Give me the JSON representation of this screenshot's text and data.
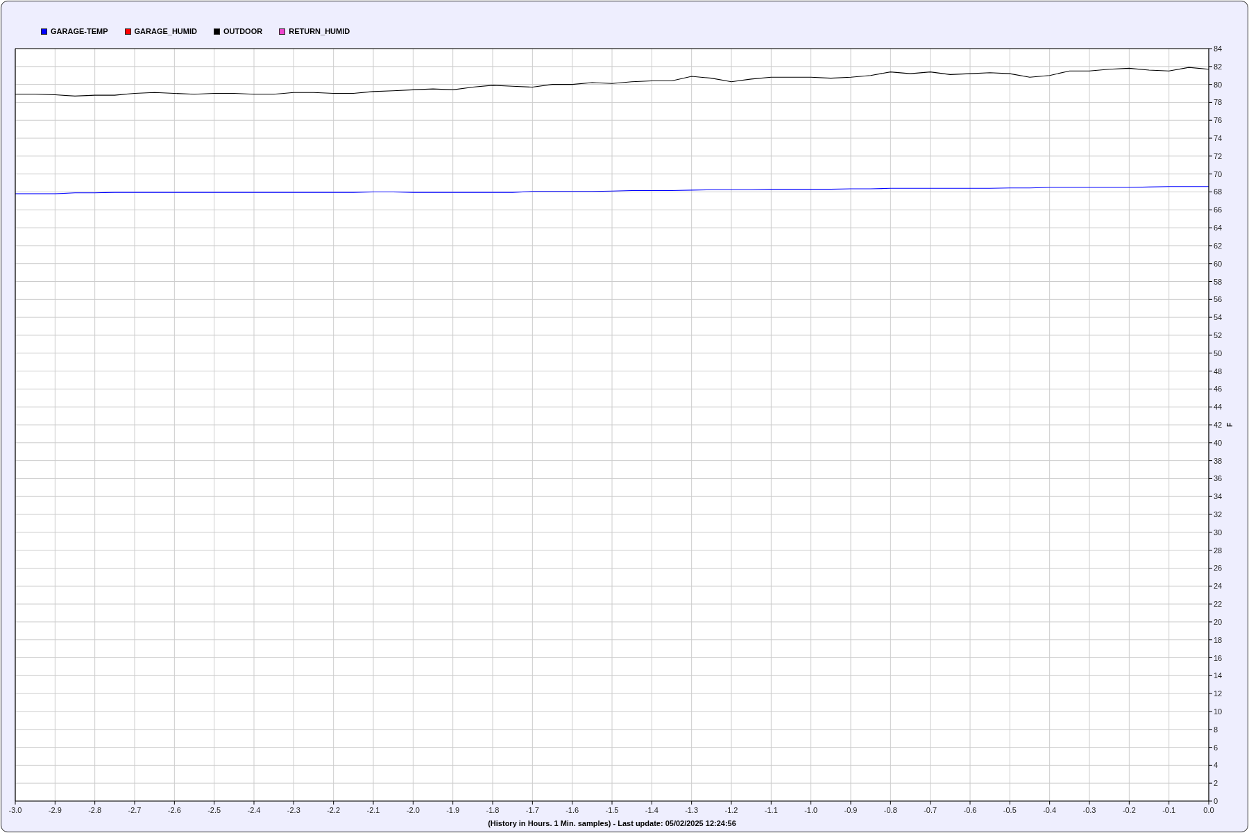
{
  "chart": {
    "chart_data": {
      "type": "line",
      "grid": true,
      "xlabel": "(History in Hours. 1 Min. samples) - Last update: 05/02/2025 12:24:56",
      "ylabel": "F",
      "x": [
        -3.0,
        -2.95,
        -2.9,
        -2.85,
        -2.8,
        -2.75,
        -2.7,
        -2.65,
        -2.6,
        -2.55,
        -2.5,
        -2.45,
        -2.4,
        -2.35,
        -2.3,
        -2.25,
        -2.2,
        -2.15,
        -2.1,
        -2.05,
        -2.0,
        -1.95,
        -1.9,
        -1.85,
        -1.8,
        -1.75,
        -1.7,
        -1.65,
        -1.6,
        -1.55,
        -1.5,
        -1.45,
        -1.4,
        -1.35,
        -1.3,
        -1.25,
        -1.2,
        -1.15,
        -1.1,
        -1.05,
        -1.0,
        -0.95,
        -0.9,
        -0.85,
        -0.8,
        -0.75,
        -0.7,
        -0.65,
        -0.6,
        -0.55,
        -0.5,
        -0.45,
        -0.4,
        -0.35,
        -0.3,
        -0.25,
        -0.2,
        -0.15,
        -0.1,
        -0.05,
        0.0
      ],
      "series": [
        {
          "name": "GARAGE-TEMP",
          "color": "#0000ff",
          "values": [
            67.8,
            67.8,
            67.8,
            67.9,
            67.9,
            67.95,
            67.95,
            67.95,
            67.95,
            67.95,
            67.95,
            67.95,
            67.95,
            67.95,
            67.95,
            67.95,
            67.95,
            67.95,
            68.0,
            68.0,
            67.95,
            67.95,
            67.95,
            67.95,
            67.95,
            67.95,
            68.05,
            68.05,
            68.05,
            68.05,
            68.1,
            68.15,
            68.15,
            68.15,
            68.2,
            68.25,
            68.25,
            68.25,
            68.3,
            68.3,
            68.3,
            68.3,
            68.35,
            68.35,
            68.4,
            68.4,
            68.4,
            68.4,
            68.4,
            68.4,
            68.45,
            68.45,
            68.5,
            68.5,
            68.5,
            68.5,
            68.5,
            68.55,
            68.6,
            68.6,
            68.6
          ]
        },
        {
          "name": "GARAGE_HUMID",
          "color": "#ff0000",
          "values": [
            null,
            null,
            null,
            null,
            null,
            null,
            null,
            null,
            null,
            null,
            null,
            null,
            null,
            null,
            null,
            null,
            null,
            null,
            null,
            null,
            null,
            null,
            null,
            null,
            null,
            null,
            null,
            null,
            null,
            null,
            null,
            null,
            null,
            null,
            null,
            null,
            null,
            null,
            null,
            null,
            null,
            null,
            null,
            null,
            null,
            null,
            null,
            null,
            null,
            null,
            null,
            null,
            null,
            null,
            null,
            null,
            null,
            null,
            null,
            null,
            null
          ]
        },
        {
          "name": "OUTDOOR",
          "color": "#000000",
          "values": [
            78.9,
            78.9,
            78.85,
            78.7,
            78.8,
            78.8,
            79.0,
            79.1,
            79.0,
            78.9,
            79.0,
            79.0,
            78.9,
            78.9,
            79.1,
            79.1,
            79.0,
            79.0,
            79.2,
            79.3,
            79.4,
            79.5,
            79.4,
            79.7,
            79.9,
            79.8,
            79.7,
            80.0,
            80.0,
            80.2,
            80.1,
            80.3,
            80.4,
            80.4,
            80.9,
            80.7,
            80.3,
            80.6,
            80.8,
            80.8,
            80.8,
            80.7,
            80.8,
            81.0,
            81.4,
            81.2,
            81.4,
            81.1,
            81.2,
            81.3,
            81.2,
            80.8,
            81.0,
            81.5,
            81.5,
            81.7,
            81.8,
            81.6,
            81.5,
            81.9,
            81.7
          ]
        },
        {
          "name": "RETURN_HUMID",
          "color": "#ee44cc",
          "values": [
            null,
            null,
            null,
            null,
            null,
            null,
            null,
            null,
            null,
            null,
            null,
            null,
            null,
            null,
            null,
            null,
            null,
            null,
            null,
            null,
            null,
            null,
            null,
            null,
            null,
            null,
            null,
            null,
            null,
            null,
            null,
            null,
            null,
            null,
            null,
            null,
            null,
            null,
            null,
            null,
            null,
            null,
            null,
            null,
            null,
            null,
            null,
            null,
            null,
            null,
            null,
            null,
            null,
            null,
            null,
            null,
            null,
            null,
            null,
            null,
            null
          ]
        }
      ],
      "xlim": [
        -3.0,
        0.0
      ],
      "ylim": [
        0,
        84
      ],
      "xticks": [
        {
          "value": -3.0,
          "label": "-3.0"
        },
        {
          "value": -2.9,
          "label": "-2.9"
        },
        {
          "value": -2.8,
          "label": "-2.8"
        },
        {
          "value": -2.7,
          "label": "-2.7"
        },
        {
          "value": -2.6,
          "label": "-2.6"
        },
        {
          "value": -2.5,
          "label": "-2.5"
        },
        {
          "value": -2.4,
          "label": "-2.4"
        },
        {
          "value": -2.3,
          "label": "-2.3"
        },
        {
          "value": -2.2,
          "label": "-2.2"
        },
        {
          "value": -2.1,
          "label": "-2.1"
        },
        {
          "value": -2.0,
          "label": "-2.0"
        },
        {
          "value": -1.9,
          "label": "-1.9"
        },
        {
          "value": -1.8,
          "label": "-1.8"
        },
        {
          "value": -1.7,
          "label": "-1.7"
        },
        {
          "value": -1.6,
          "label": "-1.6"
        },
        {
          "value": -1.5,
          "label": "-1.5"
        },
        {
          "value": -1.4,
          "label": "-1.4"
        },
        {
          "value": -1.3,
          "label": "-1.3"
        },
        {
          "value": -1.2,
          "label": "-1.2"
        },
        {
          "value": -1.1,
          "label": "-1.1"
        },
        {
          "value": -1.0,
          "label": "-1.0"
        },
        {
          "value": -0.9,
          "label": "-0.9"
        },
        {
          "value": -0.8,
          "label": "-0.8"
        },
        {
          "value": -0.7,
          "label": "-0.7"
        },
        {
          "value": -0.6,
          "label": "-0.6"
        },
        {
          "value": -0.5,
          "label": "-0.5"
        },
        {
          "value": -0.4,
          "label": "-0.4"
        },
        {
          "value": -0.3,
          "label": "-0.3"
        },
        {
          "value": -0.2,
          "label": "-0.2"
        },
        {
          "value": -0.1,
          "label": "-0.1"
        },
        {
          "value": 0.0,
          "label": "0.0"
        }
      ],
      "yticks": [
        0,
        2,
        4,
        6,
        8,
        10,
        12,
        14,
        16,
        18,
        20,
        22,
        24,
        26,
        28,
        30,
        32,
        34,
        36,
        38,
        40,
        42,
        44,
        46,
        48,
        50,
        52,
        54,
        56,
        58,
        60,
        62,
        64,
        66,
        68,
        70,
        72,
        74,
        76,
        78,
        80,
        82,
        84
      ]
    }
  }
}
